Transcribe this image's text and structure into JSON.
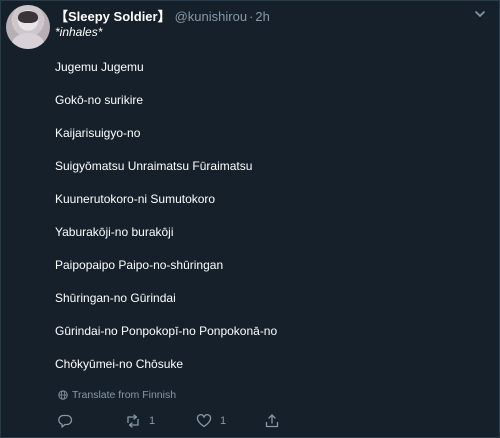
{
  "tweet": {
    "display_name": "【Sleepy Soldier】",
    "handle": "@kunishirou",
    "separator": "·",
    "time": "2h",
    "intro": "*inhales*",
    "lines": [
      "Jugemu Jugemu",
      "Gokō-no surikire",
      "Kaijarisuigyo-no",
      "Suigyōmatsu Unraimatsu Fūraimatsu",
      "Kuunerutokoro-ni Sumutokoro",
      "Yaburakōji-no burakōji",
      "Paipopaipo Paipo-no-shūringan",
      "Shūringan-no Gūrindai",
      "Gūrindai-no Ponpokopī-no Ponpokonā-no",
      "Chōkyūmei-no Chōsuke"
    ],
    "translate_label": "Translate from Finnish",
    "actions": {
      "reply_icon": "reply-icon",
      "retweet_icon": "retweet-icon",
      "retweet_count": "1",
      "like_icon": "heart-icon",
      "like_count": "1",
      "share_icon": "share-icon"
    }
  },
  "colors": {
    "background": "#15202b",
    "text": "#ffffff",
    "secondary": "#8899a6"
  }
}
